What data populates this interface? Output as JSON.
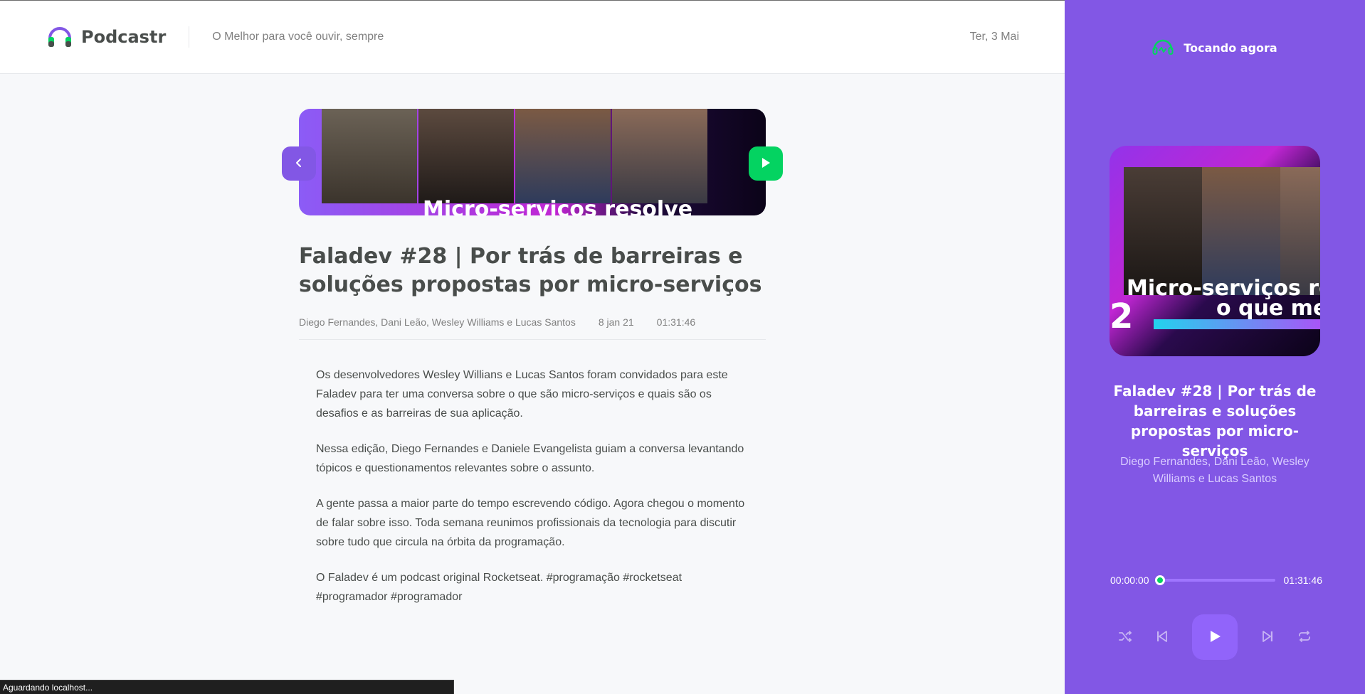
{
  "header": {
    "app_name": "Podcastr",
    "tagline": "O Melhor para você ouvir, sempre",
    "date": "Ter, 3 Mai"
  },
  "episode": {
    "thumb_banner": "Micro-serviços resolve",
    "title": "Faladev #28 | Por trás de barreiras e soluções propostas por micro-serviços",
    "members": "Diego Fernandes, Dani Leão, Wesley Williams e Lucas Santos",
    "published_at": "8 jan 21",
    "duration": "01:31:46",
    "description": [
      "Os desenvolvedores Wesley Willians e Lucas Santos foram convidados para este Faladev para ter uma conversa sobre o que são micro-serviços e quais são os desafios e as barreiras de sua aplicação.",
      "Nessa edição, Diego Fernandes e Daniele Evangelista guiam a conversa levantando tópicos e questionamentos relevantes sobre o assunto.",
      "A gente passa a maior parte do tempo escrevendo código. Agora chegou o momento de falar sobre isso. Toda semana reunimos profissionais da tecnologia para discutir sobre tudo que circula na órbita da programação.",
      "O Faladev é um podcast original Rocketseat. #programação #rocketseat #programador #programador"
    ]
  },
  "player": {
    "heading": "Tocando agora",
    "cover_text_line1": "Micro-serviços re",
    "cover_text_line2": "o que me",
    "cover_number": "2",
    "title": "Faladev #28 | Por trás de barreiras e soluções propostas por micro-serviços",
    "members": "Diego Fernandes, Dani Leão, Wesley Williams e Lucas Santos",
    "current_time": "00:00:00",
    "total_time": "01:31:46",
    "progress": 0
  },
  "status_bar": "Aguardando localhost...",
  "icons": {
    "logo": "headphones-icon",
    "back": "chevron-left-icon",
    "play": "play-icon",
    "shuffle": "shuffle-icon",
    "previous": "skip-previous-icon",
    "next": "skip-next-icon",
    "repeat": "repeat-icon"
  },
  "colors": {
    "purple": "#8257e5",
    "green": "#04d361",
    "text": "#494d4b",
    "muted": "#808080"
  }
}
